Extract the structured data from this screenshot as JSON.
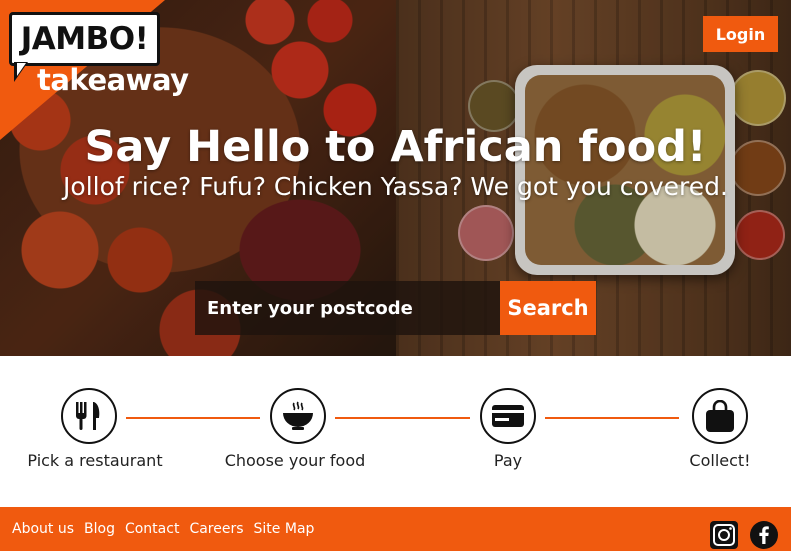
{
  "brand": {
    "logo_word": "JAMBO!",
    "logo_sub": "takeaway",
    "accent": "#f05a0f"
  },
  "header": {
    "login_label": "Login"
  },
  "hero": {
    "headline": "Say Hello to African food!",
    "subhead": "Jollof rice? Fufu? Chicken Yassa? We got you covered.",
    "postcode_placeholder": "Enter your postcode",
    "search_label": "Search"
  },
  "steps": [
    {
      "label": "Pick a restaurant",
      "icon": "cutlery-icon"
    },
    {
      "label": "Choose your food",
      "icon": "bowl-icon"
    },
    {
      "label": "Pay",
      "icon": "card-icon"
    },
    {
      "label": "Collect!",
      "icon": "bag-icon"
    }
  ],
  "footer": {
    "links": [
      "About us",
      "Blog",
      "Contact",
      "Careers",
      "Site Map"
    ],
    "social": [
      "instagram-icon",
      "facebook-icon"
    ]
  }
}
